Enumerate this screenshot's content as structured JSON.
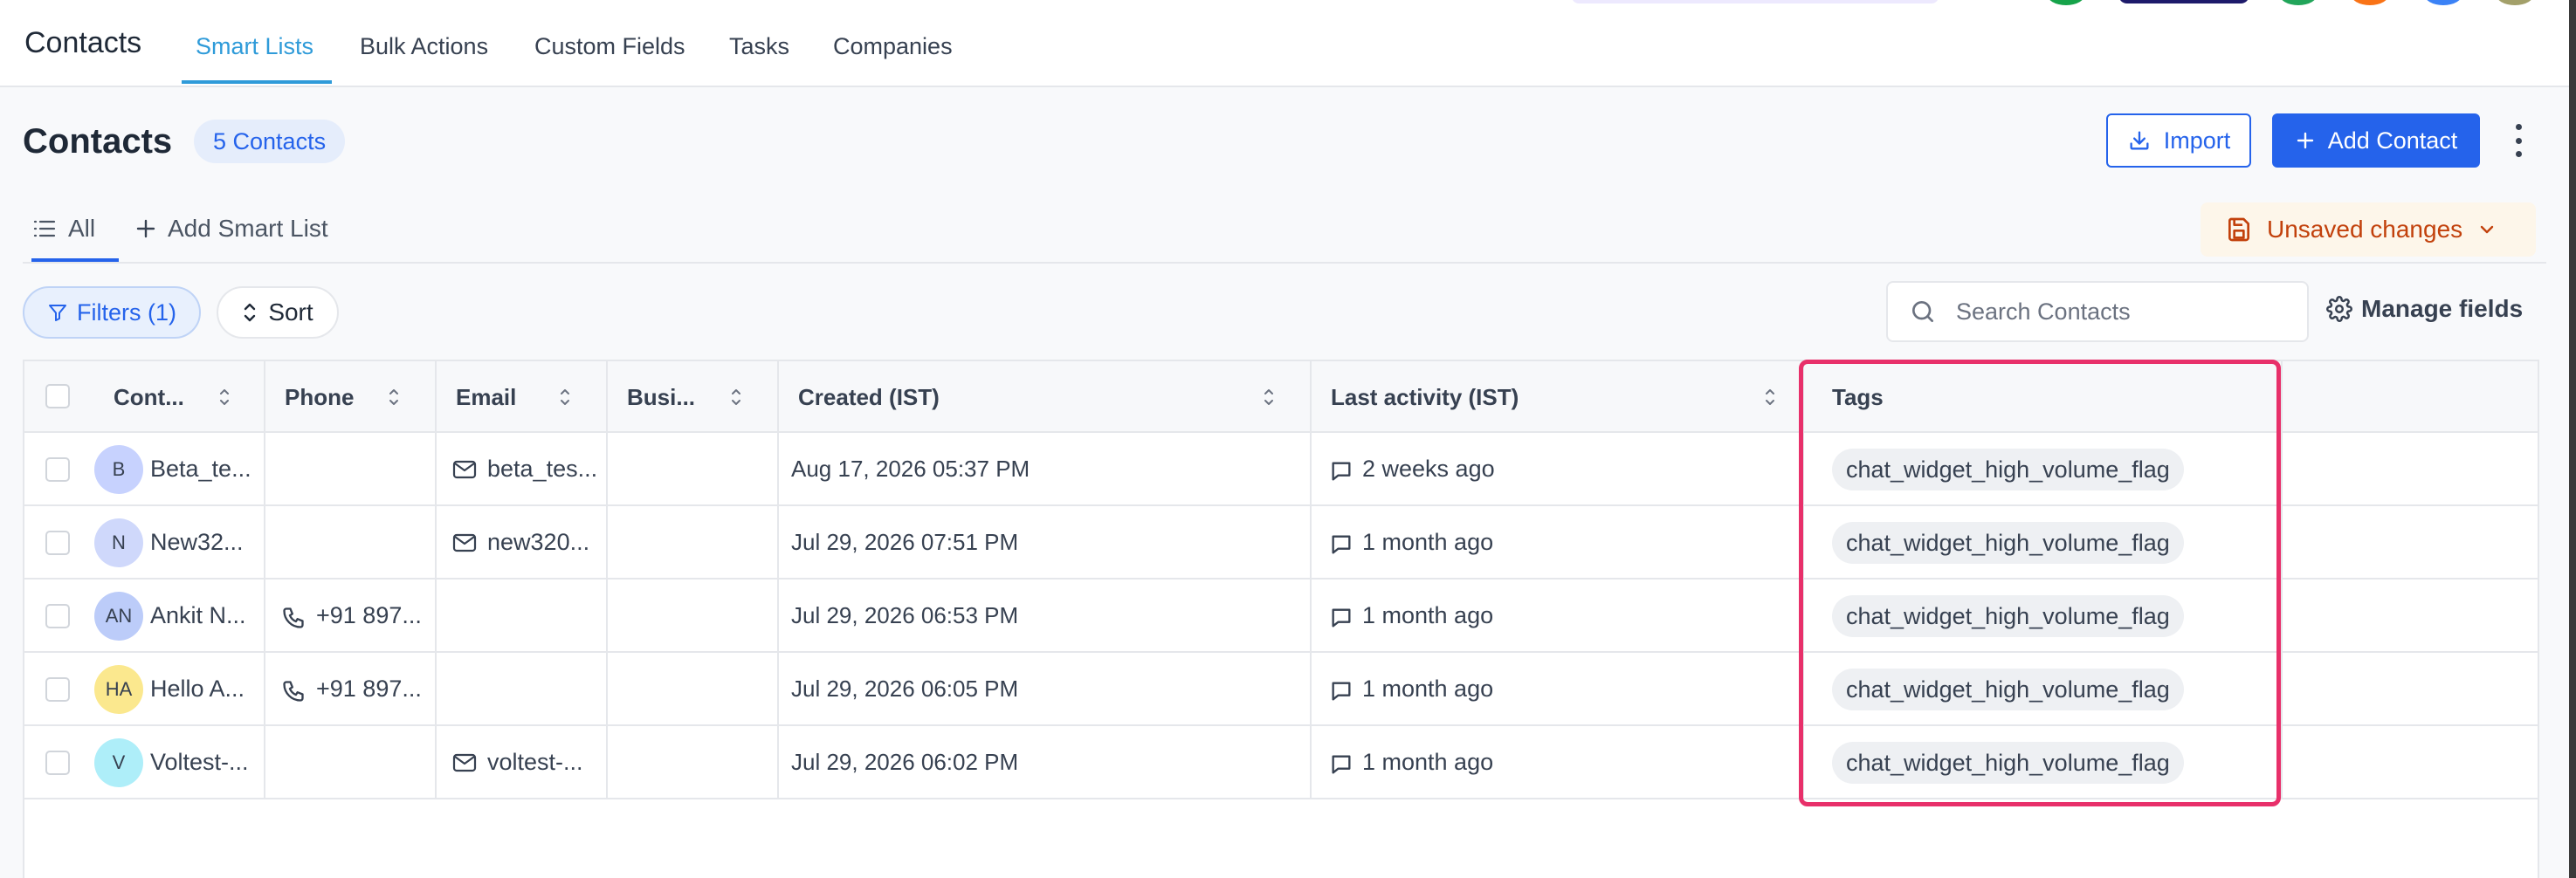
{
  "app": {
    "title": "Contacts",
    "nav_tabs": [
      "Smart Lists",
      "Bulk Actions",
      "Custom Fields",
      "Tasks",
      "Companies"
    ]
  },
  "header": {
    "title": "Contacts",
    "count_badge": "5 Contacts",
    "import_label": "Import",
    "add_contact_label": "Add Contact"
  },
  "subtabs": {
    "all_label": "All",
    "add_smart_list_label": "Add Smart List",
    "unsaved_label": "Unsaved changes"
  },
  "toolbar": {
    "filters_label": "Filters (1)",
    "sort_label": "Sort",
    "search_placeholder": "Search Contacts",
    "manage_fields_label": "Manage fields"
  },
  "table": {
    "columns": [
      "Cont...",
      "Phone",
      "Email",
      "Busi...",
      "Created (IST)",
      "Last activity (IST)",
      "Tags"
    ],
    "rows": [
      {
        "initials": "B",
        "avatar_color": "#c7d2fe",
        "name": "Beta_te...",
        "phone": "",
        "email": "beta_tes...",
        "created": "Aug 17, 2026  05:37 PM",
        "activity": "2 weeks ago",
        "tag": "chat_widget_high_volume_flag"
      },
      {
        "initials": "N",
        "avatar_color": "#cfd8fb",
        "name": "New32...",
        "phone": "",
        "email": "new320...",
        "created": "Jul 29, 2026  07:51 PM",
        "activity": "1 month ago",
        "tag": "chat_widget_high_volume_flag"
      },
      {
        "initials": "AN",
        "avatar_color": "#bcccf9",
        "name": "Ankit N...",
        "phone": "+91 897...",
        "email": "",
        "created": "Jul 29, 2026  06:53 PM",
        "activity": "1 month ago",
        "tag": "chat_widget_high_volume_flag"
      },
      {
        "initials": "HA",
        "avatar_color": "#fbe88e",
        "name": "Hello A...",
        "phone": "+91 897...",
        "email": "",
        "created": "Jul 29, 2026  06:05 PM",
        "activity": "1 month ago",
        "tag": "chat_widget_high_volume_flag"
      },
      {
        "initials": "V",
        "avatar_color": "#aeeef9",
        "name": "Voltest-...",
        "phone": "",
        "email": "voltest-...",
        "created": "Jul 29, 2026  06:02 PM",
        "activity": "1 month ago",
        "tag": "chat_widget_high_volume_flag"
      }
    ]
  },
  "colors": {
    "accent": "#2563eb",
    "nav_active": "#2f9bd9",
    "unsaved": "#c2410c",
    "highlight": "#e8306a"
  }
}
